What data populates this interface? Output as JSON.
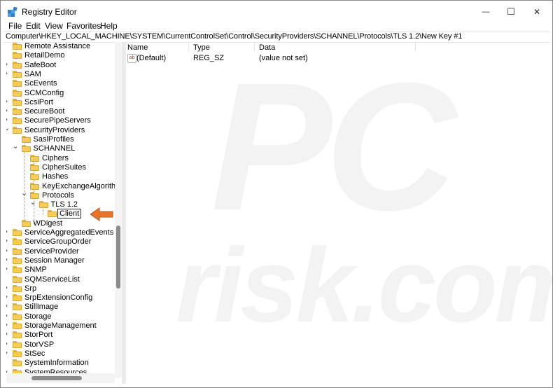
{
  "window": {
    "title": "Registry Editor",
    "menu": [
      "File",
      "Edit",
      "View",
      "Favorites",
      "Help"
    ],
    "controls": {
      "minimize": "—",
      "maximize": "☐",
      "close": "✕"
    }
  },
  "address": "Computer\\HKEY_LOCAL_MACHINE\\SYSTEM\\CurrentControlSet\\Control\\SecurityProviders\\SCHANNEL\\Protocols\\TLS 1.2\\New Key #1",
  "tree": {
    "items": [
      {
        "label": "Remote Assistance",
        "expander": ""
      },
      {
        "label": "RetailDemo",
        "expander": ""
      },
      {
        "label": "SafeBoot",
        "expander": ">"
      },
      {
        "label": "SAM",
        "expander": ">"
      },
      {
        "label": "ScEvents",
        "expander": ""
      },
      {
        "label": "SCMConfig",
        "expander": ""
      },
      {
        "label": "ScsiPort",
        "expander": ">"
      },
      {
        "label": "SecureBoot",
        "expander": ">"
      },
      {
        "label": "SecurePipeServers",
        "expander": ">"
      },
      {
        "label": "SecurityProviders",
        "expander": "v"
      },
      {
        "label": "SaslProfiles",
        "expander": ""
      },
      {
        "label": "SCHANNEL",
        "expander": "v"
      },
      {
        "label": "Ciphers",
        "expander": ""
      },
      {
        "label": "CipherSuites",
        "expander": ""
      },
      {
        "label": "Hashes",
        "expander": ""
      },
      {
        "label": "KeyExchangeAlgorithm",
        "expander": ""
      },
      {
        "label": "Protocols",
        "expander": "v"
      },
      {
        "label": "TLS 1.2",
        "expander": "v"
      },
      {
        "label": "Client",
        "expander": ""
      },
      {
        "label": "WDigest",
        "expander": ""
      },
      {
        "label": "ServiceAggregatedEvents",
        "expander": ">"
      },
      {
        "label": "ServiceGroupOrder",
        "expander": ">"
      },
      {
        "label": "ServiceProvider",
        "expander": ">"
      },
      {
        "label": "Session Manager",
        "expander": ">"
      },
      {
        "label": "SNMP",
        "expander": ">"
      },
      {
        "label": "SQMServiceList",
        "expander": ""
      },
      {
        "label": "Srp",
        "expander": ">"
      },
      {
        "label": "SrpExtensionConfig",
        "expander": ">"
      },
      {
        "label": "StillImage",
        "expander": ">"
      },
      {
        "label": "Storage",
        "expander": ">"
      },
      {
        "label": "StorageManagement",
        "expander": ">"
      },
      {
        "label": "StorPort",
        "expander": ">"
      },
      {
        "label": "StorVSP",
        "expander": ">"
      },
      {
        "label": "StSec",
        "expander": ">"
      },
      {
        "label": "SystemInformation",
        "expander": ""
      },
      {
        "label": "SystemResources",
        "expander": ">"
      }
    ]
  },
  "list": {
    "columns": [
      "Name",
      "Type",
      "Data"
    ],
    "rows": [
      {
        "name": "(Default)",
        "type": "REG_SZ",
        "data": "(value not set)",
        "icon": "string-value-icon"
      }
    ]
  },
  "watermark": "PC risk.com",
  "colors": {
    "folder": "#f6cd55",
    "arrow": "#e8742c"
  }
}
